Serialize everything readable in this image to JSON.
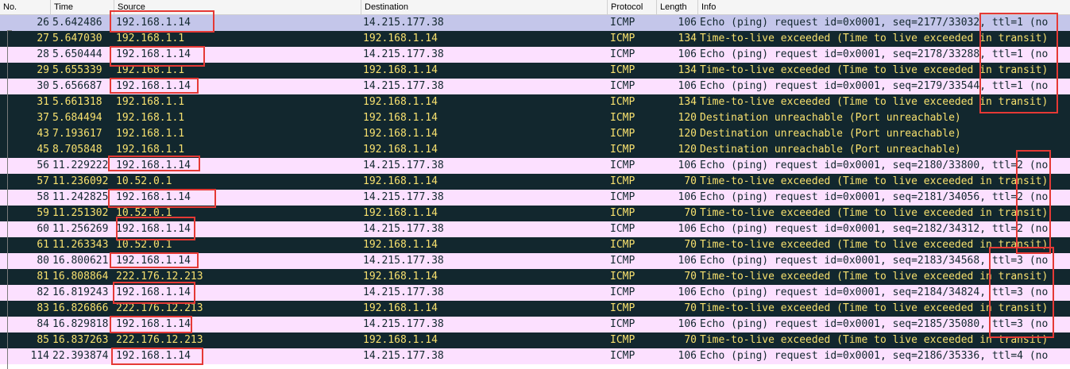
{
  "columns": {
    "no": "No.",
    "time": "Time",
    "source": "Source",
    "destination": "Destination",
    "protocol": "Protocol",
    "length": "Length",
    "info": "Info"
  },
  "packets": [
    {
      "no": "26",
      "time": "5.642486",
      "src": "192.168.1.14",
      "dst": "14.215.177.38",
      "proto": "ICMP",
      "len": "106",
      "info": "Echo (ping) request  id=0x0001, seq=2177/33032, ttl=1 (no",
      "kind": "sel"
    },
    {
      "no": "27",
      "time": "5.647030",
      "src": "192.168.1.1",
      "dst": "192.168.1.14",
      "proto": "ICMP",
      "len": "134",
      "info": "Time-to-live exceeded (Time to live exceeded in transit)",
      "kind": "err"
    },
    {
      "no": "28",
      "time": "5.650444",
      "src": "192.168.1.14",
      "dst": "14.215.177.38",
      "proto": "ICMP",
      "len": "106",
      "info": "Echo (ping) request  id=0x0001, seq=2178/33288, ttl=1 (no",
      "kind": "req"
    },
    {
      "no": "29",
      "time": "5.655339",
      "src": "192.168.1.1",
      "dst": "192.168.1.14",
      "proto": "ICMP",
      "len": "134",
      "info": "Time-to-live exceeded (Time to live exceeded in transit)",
      "kind": "err"
    },
    {
      "no": "30",
      "time": "5.656687",
      "src": "192.168.1.14",
      "dst": "14.215.177.38",
      "proto": "ICMP",
      "len": "106",
      "info": "Echo (ping) request  id=0x0001, seq=2179/33544, ttl=1 (no",
      "kind": "req"
    },
    {
      "no": "31",
      "time": "5.661318",
      "src": "192.168.1.1",
      "dst": "192.168.1.14",
      "proto": "ICMP",
      "len": "134",
      "info": "Time-to-live exceeded (Time to live exceeded in transit)",
      "kind": "err"
    },
    {
      "no": "37",
      "time": "5.684494",
      "src": "192.168.1.1",
      "dst": "192.168.1.14",
      "proto": "ICMP",
      "len": "120",
      "info": "Destination unreachable (Port unreachable)",
      "kind": "err"
    },
    {
      "no": "43",
      "time": "7.193617",
      "src": "192.168.1.1",
      "dst": "192.168.1.14",
      "proto": "ICMP",
      "len": "120",
      "info": "Destination unreachable (Port unreachable)",
      "kind": "err"
    },
    {
      "no": "45",
      "time": "8.705848",
      "src": "192.168.1.1",
      "dst": "192.168.1.14",
      "proto": "ICMP",
      "len": "120",
      "info": "Destination unreachable (Port unreachable)",
      "kind": "err"
    },
    {
      "no": "56",
      "time": "11.229222",
      "src": "192.168.1.14",
      "dst": "14.215.177.38",
      "proto": "ICMP",
      "len": "106",
      "info": "Echo (ping) request  id=0x0001, seq=2180/33800, ttl=2 (no",
      "kind": "req"
    },
    {
      "no": "57",
      "time": "11.236092",
      "src": "10.52.0.1",
      "dst": "192.168.1.14",
      "proto": "ICMP",
      "len": "70",
      "info": "Time-to-live exceeded (Time to live exceeded in transit)",
      "kind": "err"
    },
    {
      "no": "58",
      "time": "11.242825",
      "src": "192.168.1.14",
      "dst": "14.215.177.38",
      "proto": "ICMP",
      "len": "106",
      "info": "Echo (ping) request  id=0x0001, seq=2181/34056, ttl=2 (no",
      "kind": "req"
    },
    {
      "no": "59",
      "time": "11.251302",
      "src": "10.52.0.1",
      "dst": "192.168.1.14",
      "proto": "ICMP",
      "len": "70",
      "info": "Time-to-live exceeded (Time to live exceeded in transit)",
      "kind": "err"
    },
    {
      "no": "60",
      "time": "11.256269",
      "src": "192.168.1.14",
      "dst": "14.215.177.38",
      "proto": "ICMP",
      "len": "106",
      "info": "Echo (ping) request  id=0x0001, seq=2182/34312, ttl=2 (no",
      "kind": "req"
    },
    {
      "no": "61",
      "time": "11.263343",
      "src": "10.52.0.1",
      "dst": "192.168.1.14",
      "proto": "ICMP",
      "len": "70",
      "info": "Time-to-live exceeded (Time to live exceeded in transit)",
      "kind": "err"
    },
    {
      "no": "80",
      "time": "16.800621",
      "src": "192.168.1.14",
      "dst": "14.215.177.38",
      "proto": "ICMP",
      "len": "106",
      "info": "Echo (ping) request  id=0x0001, seq=2183/34568, ttl=3 (no",
      "kind": "req"
    },
    {
      "no": "81",
      "time": "16.808864",
      "src": "222.176.12.213",
      "dst": "192.168.1.14",
      "proto": "ICMP",
      "len": "70",
      "info": "Time-to-live exceeded (Time to live exceeded in transit)",
      "kind": "err"
    },
    {
      "no": "82",
      "time": "16.819243",
      "src": "192.168.1.14",
      "dst": "14.215.177.38",
      "proto": "ICMP",
      "len": "106",
      "info": "Echo (ping) request  id=0x0001, seq=2184/34824, ttl=3 (no",
      "kind": "req"
    },
    {
      "no": "83",
      "time": "16.826866",
      "src": "222.176.12.213",
      "dst": "192.168.1.14",
      "proto": "ICMP",
      "len": "70",
      "info": "Time-to-live exceeded (Time to live exceeded in transit)",
      "kind": "err"
    },
    {
      "no": "84",
      "time": "16.829818",
      "src": "192.168.1.14",
      "dst": "14.215.177.38",
      "proto": "ICMP",
      "len": "106",
      "info": "Echo (ping) request  id=0x0001, seq=2185/35080, ttl=3 (no",
      "kind": "req"
    },
    {
      "no": "85",
      "time": "16.837263",
      "src": "222.176.12.213",
      "dst": "192.168.1.14",
      "proto": "ICMP",
      "len": "70",
      "info": "Time-to-live exceeded (Time to live exceeded in transit)",
      "kind": "err"
    },
    {
      "no": "114",
      "time": "22.393874",
      "src": "192.168.1.14",
      "dst": "14.215.177.38",
      "proto": "ICMP",
      "len": "106",
      "info": "Echo (ping) request  id=0x0001, seq=2186/35336, ttl=4 (no",
      "kind": "req"
    }
  ],
  "colors": {
    "request_bg": "#fce0ff",
    "error_bg": "#12272e",
    "error_fg": "#f7e06e",
    "selected_bg": "#c4c6ea",
    "highlight_box": "#e53935"
  },
  "annotations": {
    "source_boxes": "highlights Source column values 192.168.1.14",
    "info_boxes": "highlights ttl / in transit in Info column"
  }
}
